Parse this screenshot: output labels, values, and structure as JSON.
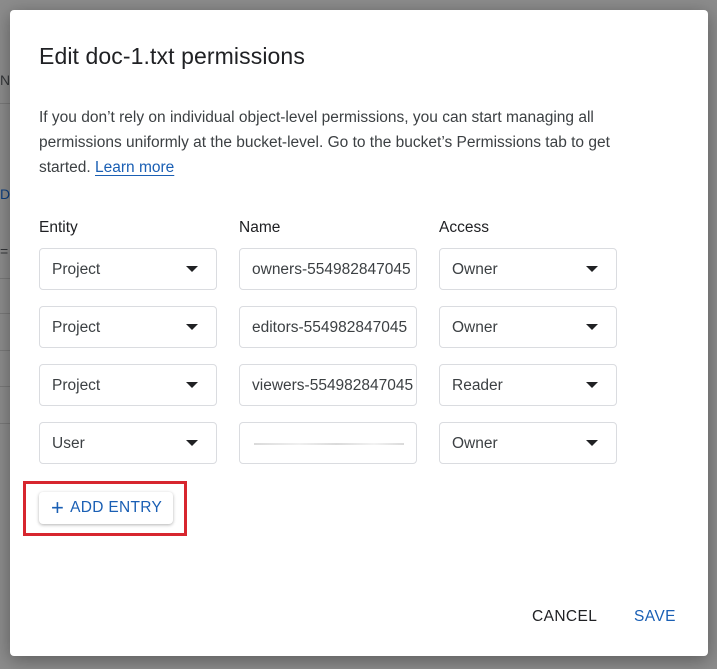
{
  "background": {
    "glyphs": [
      "N",
      "D",
      "="
    ]
  },
  "dialog": {
    "title": "Edit doc-1.txt permissions",
    "description": "If you don’t rely on individual object-level permissions, you can start managing all permissions uniformly at the bucket-level. Go to the bucket’s Permissions tab to get started. ",
    "learn_more": "Learn more",
    "columns": {
      "entity": "Entity",
      "name": "Name",
      "access": "Access"
    },
    "rows": [
      {
        "entity": "Project",
        "name": "owners-554982847045",
        "access": "Owner"
      },
      {
        "entity": "Project",
        "name": "editors-554982847045",
        "access": "Owner"
      },
      {
        "entity": "Project",
        "name": "viewers-554982847045",
        "access": "Reader"
      },
      {
        "entity": "User",
        "name": "",
        "access": "Owner"
      }
    ],
    "add_entry_label": "ADD ENTRY",
    "cancel_label": "CANCEL",
    "save_label": "SAVE"
  },
  "colors": {
    "accent": "#1a5fb4",
    "highlight": "#d7262e"
  }
}
